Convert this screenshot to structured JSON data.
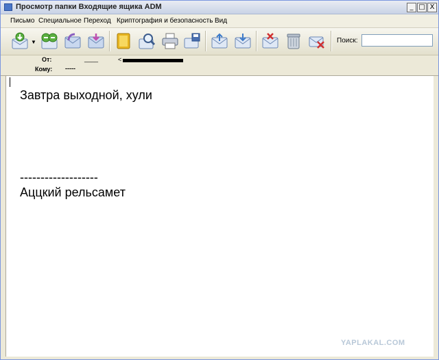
{
  "window": {
    "title": "Просмотр папки Входящие ящика ADM",
    "controls": {
      "minimize": "_",
      "maximize": "□",
      "close": "X"
    }
  },
  "menu": [
    "Письмо",
    "Специальное",
    "Переход",
    "Криптография и безопасность",
    "Вид"
  ],
  "toolbar": {
    "buttons": [
      {
        "name": "get-mail",
        "icon": "mail-receive-icon"
      },
      {
        "name": "send-receive",
        "icon": "mail-exchange-icon"
      },
      {
        "name": "reply",
        "icon": "envelope-reply-icon"
      },
      {
        "name": "forward",
        "icon": "envelope-forward-icon"
      },
      {
        "name": "address-book",
        "icon": "address-book-icon"
      },
      {
        "name": "find",
        "icon": "magnifier-icon"
      },
      {
        "name": "print",
        "icon": "printer-icon"
      },
      {
        "name": "save",
        "icon": "save-envelope-icon"
      },
      {
        "name": "prev",
        "icon": "envelope-up-icon"
      },
      {
        "name": "next",
        "icon": "envelope-down-icon"
      },
      {
        "name": "mark-delete",
        "icon": "envelope-x-icon"
      },
      {
        "name": "trash",
        "icon": "trash-icon"
      },
      {
        "name": "delete",
        "icon": "envelope-delete-icon"
      }
    ],
    "search_label": "Поиск:",
    "search_value": ""
  },
  "header": {
    "from_label": "От:",
    "to_label": "Кому:",
    "from_value": "____",
    "from_bracket": "<",
    "to_value": "-----"
  },
  "message": {
    "line1": "Завтра выходной, хули",
    "separator": "-------------------",
    "signature": "Аццкий рельсамет"
  },
  "watermark": "YAPLAKAL.COM"
}
